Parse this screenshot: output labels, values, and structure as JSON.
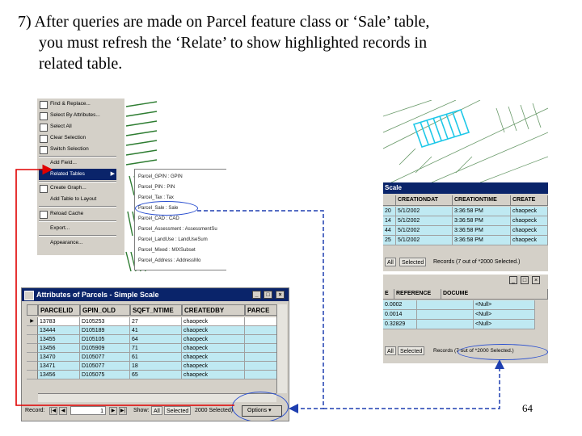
{
  "title_line1": "7) After queries are made on Parcel feature class or ‘Sale’ table,",
  "title_line2": "you must refresh the ‘Relate’ to show highlighted records in",
  "title_line3": "related table.",
  "slide_number": "64",
  "colors": {
    "selection": "#bfe9f2",
    "annotation_red": "#e00000",
    "annotation_blue": "#2a4fd0",
    "title_bar": "#0a246a",
    "map_lines": "#2e7d32"
  },
  "menu": {
    "items": [
      "Find & Replace...",
      "Select By Attributes...",
      "Select All",
      "Clear Selection",
      "Switch Selection",
      "Add Field...",
      "Related Tables",
      "Create Graph...",
      "Add Table to Layout",
      "Reload Cache",
      "Export...",
      "Appearance..."
    ],
    "submenu": [
      "Parcel_GPIN : GPIN",
      "Parcel_PIN : PIN",
      "Parcel_Tax : Tax",
      "Parcel_Sale : Sale",
      "Parcel_CAD : CAD",
      "Parcel_Assessment : AssessmentSu",
      "Parcel_LandUse : LandUseSum",
      "Parcel_Mixed : MIXSubset",
      "Parcel_Address : AddressMo"
    ]
  },
  "right_top": {
    "window_title": "Scale",
    "headers": [
      "CREATIONDAT",
      "CREATIONTIME",
      "CREATE"
    ],
    "rows": [
      [
        "5/1/2002",
        "3:36:58 PM",
        "chaopeck"
      ],
      [
        "5/1/2002",
        "3:36:58 PM",
        "chaopeck"
      ],
      [
        "5/1/2002",
        "3:36:58 PM",
        "chaopeck"
      ],
      [
        "5/1/2002",
        "3:36:58 PM",
        "chaopeck"
      ]
    ],
    "row_prefixes": [
      "20",
      "14",
      "44",
      "25"
    ],
    "status_all": "All",
    "status_selected": "Selected",
    "status_text": "Records (7 out of *2000 Selected.)"
  },
  "right_bottom": {
    "headers": [
      "E",
      "REFERENCE",
      "DOCUME"
    ],
    "rows": [
      [
        "0.0002",
        "",
        "<Null>"
      ],
      [
        "0.0014",
        "",
        "<Null>"
      ],
      [
        "0.32829",
        "",
        "<Null>"
      ]
    ],
    "status_all": "All",
    "status_selected": "Selected",
    "status_text": "Records (7 out of *2000 Selected.)"
  },
  "attributes": {
    "window_title": "Attributes of Parcels - Simple Scale",
    "ctl_min": "_",
    "ctl_max": "□",
    "ctl_close": "×",
    "headers": [
      "PARCELID",
      "GPIN_OLD",
      "SQFT_NTIME",
      "CREATEDBY",
      "PARCE"
    ],
    "rows": [
      [
        "13783",
        "D105253",
        "27",
        "chaopeck"
      ],
      [
        "13444",
        "D105189",
        "41",
        "chaopeck"
      ],
      [
        "13455",
        "D105105",
        "64",
        "chaopeck"
      ],
      [
        "13456",
        "D105909",
        "71",
        "chaopeck"
      ],
      [
        "13470",
        "D105077",
        "61",
        "chaopeck"
      ],
      [
        "13471",
        "D105077",
        "18",
        "chaopeck"
      ],
      [
        "13456",
        "D105075",
        "65",
        "chaopeck"
      ]
    ],
    "record_label": "Record:",
    "record_value": "1",
    "show_label": "Show:",
    "all_btn": "All",
    "selected_btn": "Selected",
    "records_text": "2000 Selected)",
    "options_label": "Options"
  }
}
